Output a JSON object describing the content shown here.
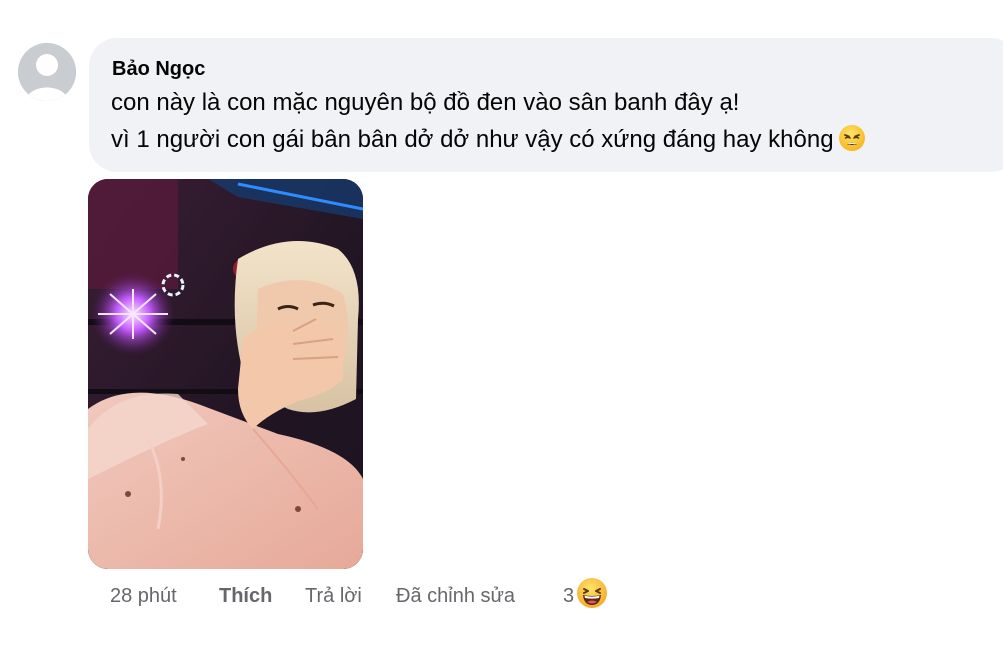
{
  "comment": {
    "author": "Bảo Ngọc",
    "lines": [
      "con này là con mặc nguyên bộ đồ đen vào sân banh đây ạ!",
      "vì 1 người con gái bân bân dở dở như vậy có xứng đáng hay không"
    ],
    "inline_emoji_icon": "tired-face-emoji-icon",
    "avatar_icon": "default-avatar-icon",
    "photo_icon": "attached-photo"
  },
  "actions": {
    "time": "28 phút",
    "like_label": "Thích",
    "reply_label": "Trả lời",
    "edited_label": "Đã chỉnh sửa",
    "reaction_count": "3",
    "reaction_icon": "laughing-face-emoji-icon"
  },
  "colors": {
    "bubble_bg": "#f0f2f5",
    "secondary_text": "#65676b",
    "primary_text": "#050505"
  }
}
